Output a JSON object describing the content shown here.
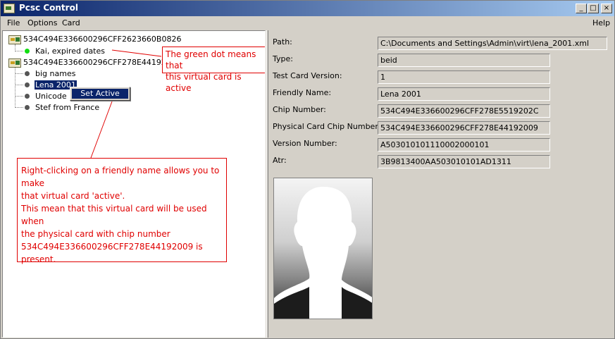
{
  "window": {
    "title": "Pcsc Control",
    "controls": {
      "minimize": "_",
      "maximize": "□",
      "close": "×"
    }
  },
  "menu": {
    "file": "File",
    "options": "Options",
    "card": "Card",
    "help": "Help"
  },
  "tree": {
    "card1": {
      "chip": "534C494E336600296CFF2623660B0826",
      "children": [
        {
          "label": "Kai, expired dates",
          "active": true
        }
      ]
    },
    "card2": {
      "chip": "534C494E336600296CFF278E44192009",
      "children": [
        {
          "label": "big names",
          "active": false
        },
        {
          "label": "Lena 2001",
          "active": false
        },
        {
          "label": "Unicode 1",
          "active": false
        },
        {
          "label": "Stef from France",
          "active": false
        }
      ]
    }
  },
  "context_menu": {
    "set_active": "Set Active"
  },
  "callouts": {
    "green_dot": [
      "The green dot means that",
      "this virtual card is active"
    ],
    "right_click": [
      "Right-clicking on a friendly name allows you to make",
      "that virtual card 'active'.",
      "This mean that this virtual card will be used when",
      "the physical card with chip number",
      "534C494E336600296CFF278E44192009 is present."
    ]
  },
  "details": {
    "path": {
      "label": "Path:",
      "value": "C:\\Documents and Settings\\Admin\\virt\\lena_2001.xml"
    },
    "type": {
      "label": "Type:",
      "value": "beid"
    },
    "test_card_version": {
      "label": "Test Card Version:",
      "value": "1"
    },
    "friendly_name": {
      "label": "Friendly Name:",
      "value": "Lena 2001"
    },
    "chip_number": {
      "label": "Chip Number:",
      "value": "534C494E336600296CFF278E5519202C"
    },
    "physical_chip_number": {
      "label": "Physical Card Chip Number:",
      "value": "534C494E336600296CFF278E44192009"
    },
    "version_number": {
      "label": "Version Number:",
      "value": "A503010101110002000101"
    },
    "atr": {
      "label": "Atr:",
      "value": "3B9813400AA503010101AD1311"
    }
  },
  "colors": {
    "title_start": "#0a246a",
    "title_end": "#a6caf0",
    "callout": "#e00000",
    "active_dot": "#11dd11",
    "selection": "#0a246a"
  },
  "icons": [
    "card-icon",
    "minimize-icon",
    "maximize-icon",
    "close-icon",
    "photo-silhouette"
  ]
}
